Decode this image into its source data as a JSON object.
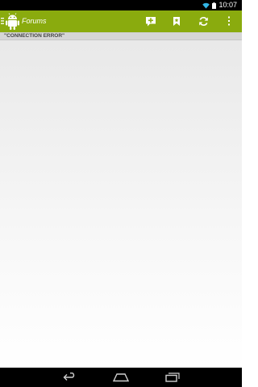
{
  "status_bar": {
    "time": "10:07",
    "wifi_icon": "wifi-icon",
    "battery_icon": "battery-icon"
  },
  "action_bar": {
    "title": "Forums",
    "color": "#8aab0e",
    "actions": [
      {
        "icon": "new-message-icon",
        "label": "New post"
      },
      {
        "icon": "bookmark-icon",
        "label": "Bookmarks"
      },
      {
        "icon": "refresh-icon",
        "label": "Refresh"
      },
      {
        "icon": "overflow-menu-icon",
        "label": "More options"
      }
    ]
  },
  "content": {
    "error_message": "\"CONNECTION ERROR\""
  },
  "nav_bar": {
    "back_icon": "back-icon",
    "home_icon": "home-icon",
    "recents_icon": "recent-apps-icon"
  }
}
